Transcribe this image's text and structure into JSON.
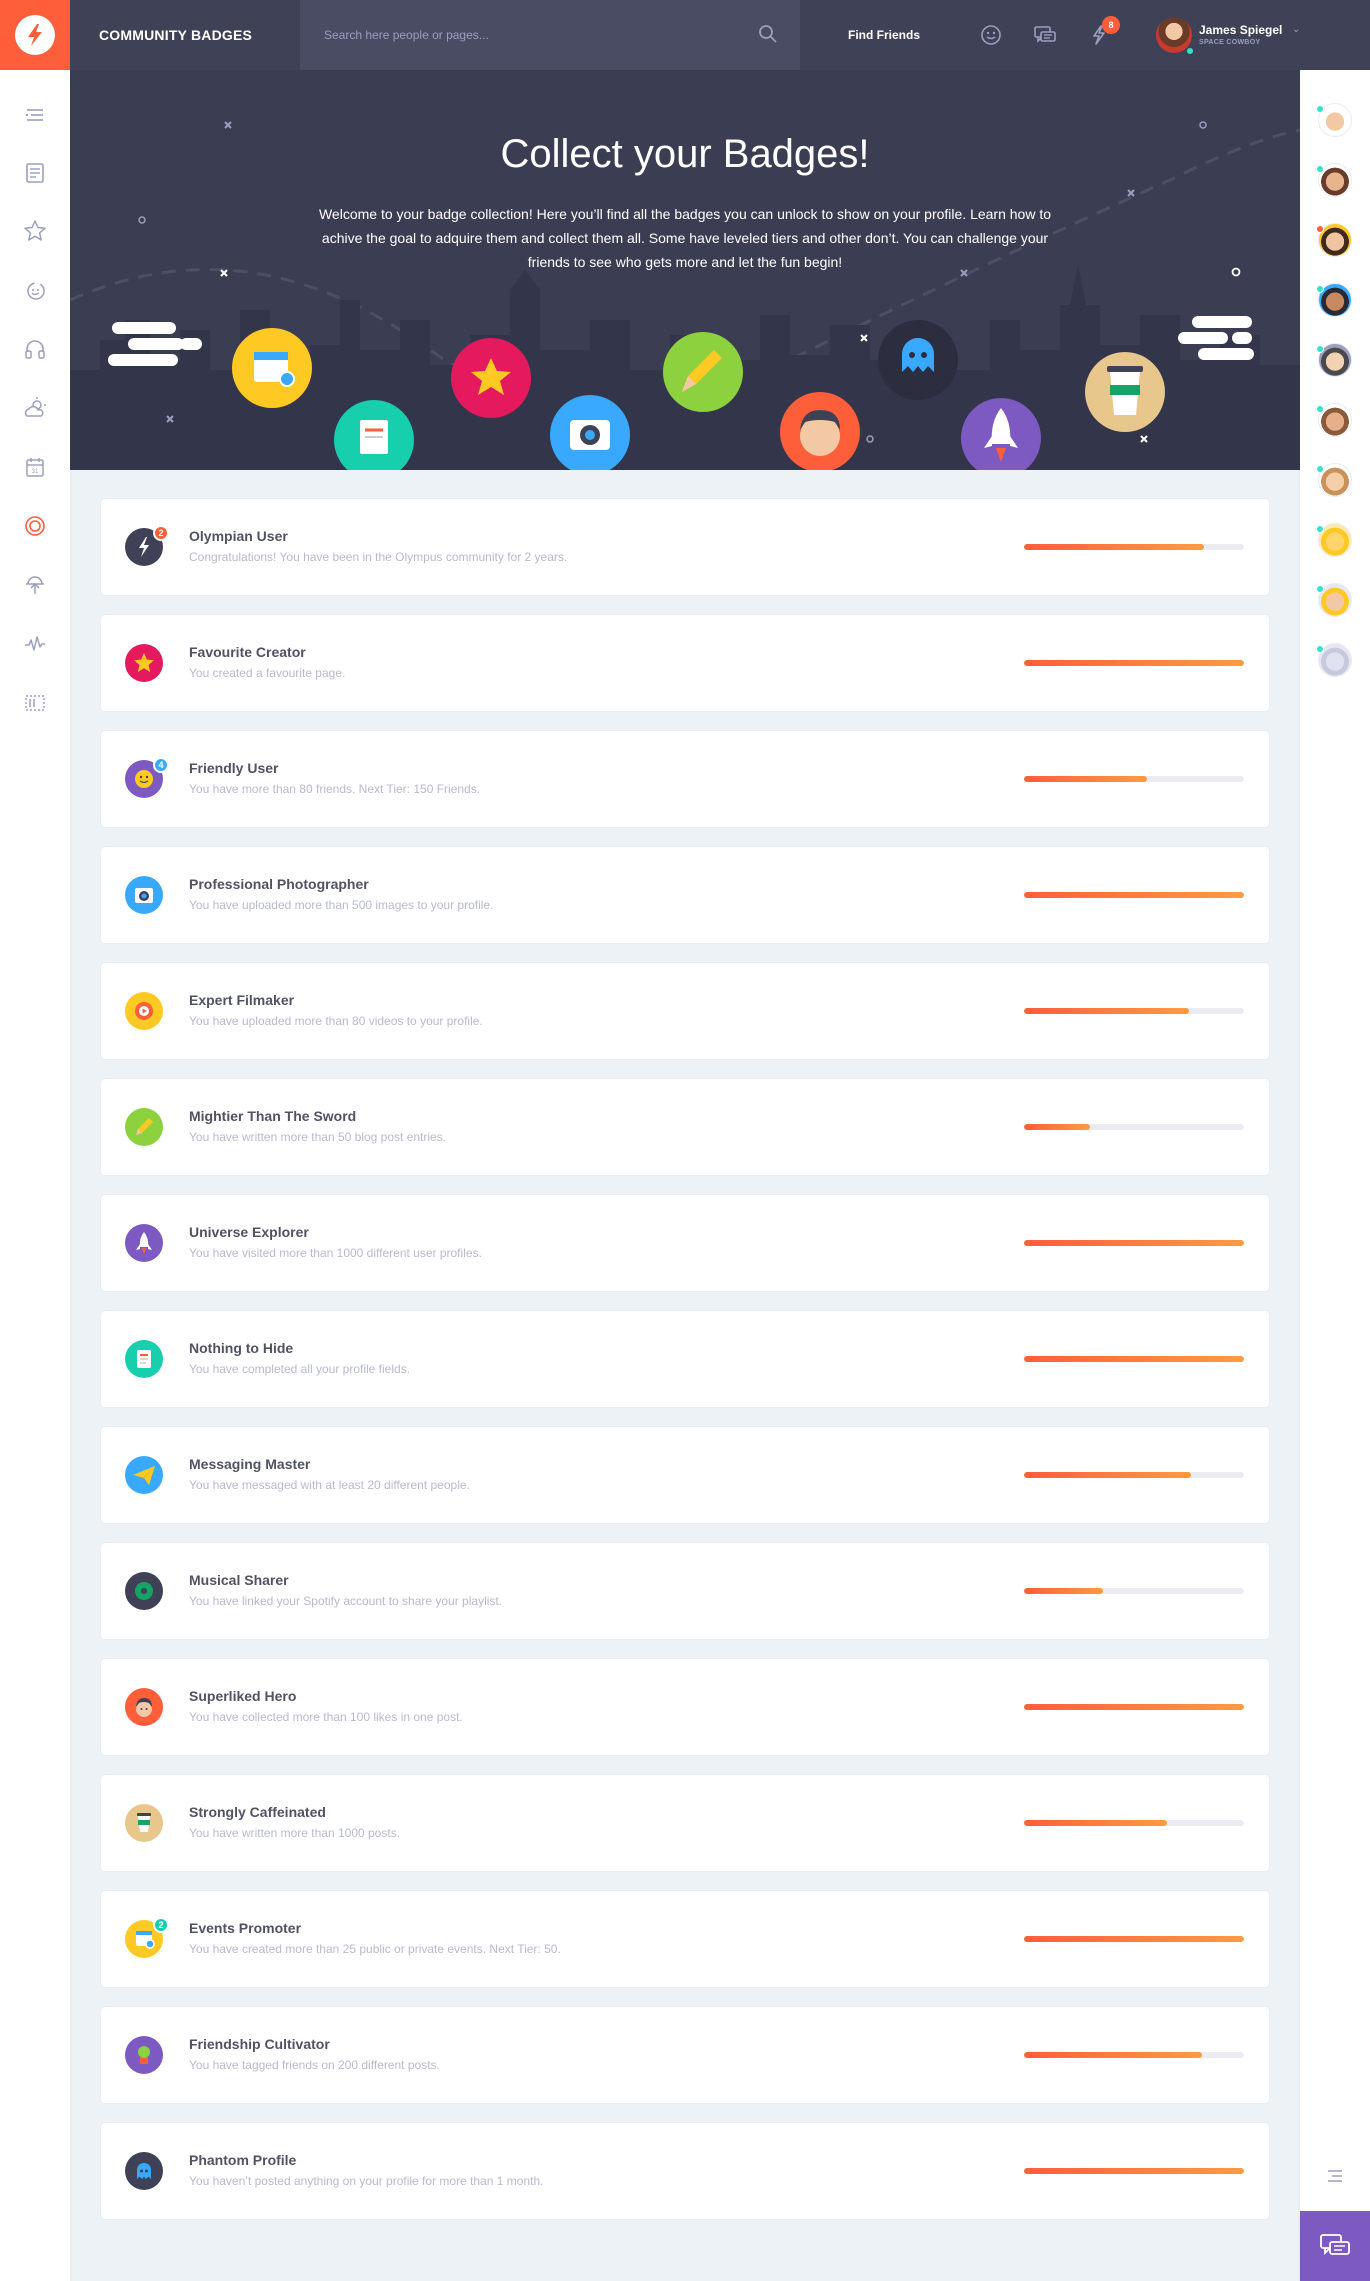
{
  "header": {
    "page_name": "COMMUNITY BADGES",
    "search_placeholder": "Search here people or pages...",
    "find_friends": "Find Friends",
    "notifications_count": "8",
    "user_name": "James Spiegel",
    "user_role": "SPACE COWBOY"
  },
  "hero": {
    "title": "Collect your Badges!",
    "text": "Welcome to your badge collection! Here you’ll find all the badges you can unlock to show on your profile. Learn how to achive the goal to adquire them and collect them all. Some have leveled tiers and other don’t. You can challenge your friends to see who gets more and let the fun begin!"
  },
  "badges": [
    {
      "title": "Olympian User",
      "desc": "Congratulations! You have been in the Olympus community for 2 years.",
      "progress": 0.82,
      "tier": "2",
      "tier_color": "#ff5e3a",
      "icon": "olympus-logo-icon",
      "color": "#3f4257"
    },
    {
      "title": "Favourite Creator",
      "desc": "You created a favourite page.",
      "progress": 1.0,
      "tier": null,
      "icon": "star-icon",
      "color": "#e5195d"
    },
    {
      "title": "Friendly User",
      "desc": "You have more than 80 friends. Next Tier: 150 Friends.",
      "progress": 0.56,
      "tier": "4",
      "tier_color": "#38a9ff",
      "icon": "smiley-icon",
      "color": "#7c5ac2"
    },
    {
      "title": "Professional Photographer",
      "desc": "You have uploaded more than 500 images to your profile.",
      "progress": 1.0,
      "tier": null,
      "icon": "camera-icon",
      "color": "#38a9ff"
    },
    {
      "title": "Expert Filmaker",
      "desc": "You have uploaded more than 80 videos to your profile.",
      "progress": 0.75,
      "tier": null,
      "icon": "film-icon",
      "color": "#ffc923"
    },
    {
      "title": "Mightier Than The Sword",
      "desc": "You have written more than 50 blog post entries.",
      "progress": 0.3,
      "tier": null,
      "icon": "pencil-icon",
      "color": "#8dd13e"
    },
    {
      "title": "Universe Explorer",
      "desc": "You have visited more than 1000 different user profiles.",
      "progress": 1.0,
      "tier": null,
      "icon": "rocket-icon",
      "color": "#7c5ac2"
    },
    {
      "title": "Nothing to Hide",
      "desc": "You have completed all your profile fields.",
      "progress": 1.0,
      "tier": null,
      "icon": "document-icon",
      "color": "#17cfad"
    },
    {
      "title": "Messaging Master",
      "desc": "You have messaged with at least 20 different people.",
      "progress": 0.76,
      "tier": null,
      "icon": "paper-plane-icon",
      "color": "#38a9ff"
    },
    {
      "title": "Musical Sharer",
      "desc": "You have linked your Spotify account to share your playlist.",
      "progress": 0.36,
      "tier": null,
      "icon": "vinyl-icon",
      "color": "#3f4257"
    },
    {
      "title": "Superliked Hero",
      "desc": "You have collected more than 100 likes in one post.",
      "progress": 1.0,
      "tier": null,
      "icon": "hero-face-icon",
      "color": "#ff5e3a"
    },
    {
      "title": "Strongly Caffeinated",
      "desc": "You have written more than 1000 posts.",
      "progress": 0.65,
      "tier": null,
      "icon": "coffee-cup-icon",
      "color": "#e8c78d"
    },
    {
      "title": "Events Promoter",
      "desc": "You have created more than 25 public or private events. Next Tier: 50.",
      "progress": 1.0,
      "tier": "2",
      "tier_color": "#17cfad",
      "icon": "calendar-icon",
      "color": "#ffc923"
    },
    {
      "title": "Friendship Cultivator",
      "desc": "You have tagged friends on 200 different posts.",
      "progress": 0.81,
      "tier": null,
      "icon": "plant-icon",
      "color": "#7c5ac2"
    },
    {
      "title": "Phantom Profile",
      "desc": "You haven’t posted anything on your profile for more than 1 month.",
      "progress": 1.0,
      "tier": null,
      "icon": "ghost-icon",
      "color": "#3f4257"
    }
  ],
  "left_sidebar_icons": [
    "menu-icon",
    "newsfeed-icon",
    "star-icon",
    "happy-faces-icon",
    "headphones-icon",
    "weather-icon",
    "calendar-icon",
    "badges-icon",
    "music-icon",
    "statistics-icon",
    "manage-widgets-icon"
  ],
  "right_sidebar_friends": [
    {
      "name": "friend-1",
      "status": "#32e4cd"
    },
    {
      "name": "friend-2",
      "status": "#32e4cd"
    },
    {
      "name": "friend-3",
      "status": "#ff5e3a"
    },
    {
      "name": "friend-4",
      "status": "#32e4cd"
    },
    {
      "name": "friend-5",
      "status": "#32e4cd"
    },
    {
      "name": "friend-6",
      "status": "#32e4cd"
    },
    {
      "name": "friend-7",
      "status": "#32e4cd"
    },
    {
      "name": "friend-8",
      "status": "#32e4cd"
    },
    {
      "name": "friend-9",
      "status": "#32e4cd"
    },
    {
      "name": "friend-10",
      "status": "#32e4cd"
    }
  ],
  "colors": {
    "accent": "#ff5e3a",
    "topbar": "#3f4257",
    "hero": "#3b3d53",
    "chat": "#7c5ac2"
  }
}
